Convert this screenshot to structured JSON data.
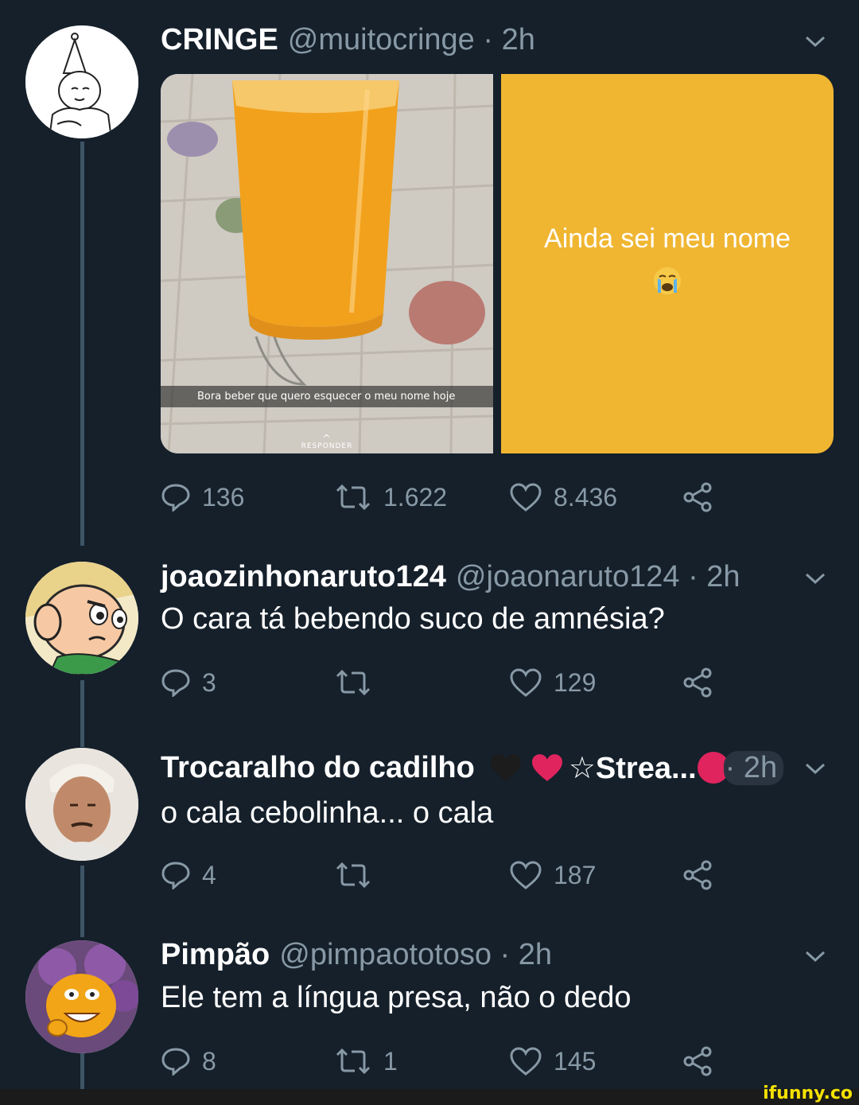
{
  "tweets": [
    {
      "name": "CRINGE",
      "handle": "@muitocringe",
      "sep": "·",
      "time": "2h",
      "media_left_caption": "Bora beber que quero esquecer o meu nome hoje",
      "media_left_reply": "RESPONDER",
      "media_right_text": "Ainda sei meu nome",
      "replies": "136",
      "retweets": "1.622",
      "likes": "8.436"
    },
    {
      "name": "joaozinhonaruto124",
      "handle": "@joaonaruto124",
      "sep": "·",
      "time": "2h",
      "text": "O cara tá bebendo suco de amnésia?",
      "replies": "3",
      "retweets": "",
      "likes": "129"
    },
    {
      "name": "Trocaralho do cadilho",
      "name_suffix": "☆Strea...",
      "sep": "·",
      "time": "2h",
      "text": "o cala cebolinha... o cala",
      "replies": "4",
      "retweets": "",
      "likes": "187"
    },
    {
      "name": "Pimpão",
      "handle": "@pimpaototoso",
      "sep": "·",
      "time": "2h",
      "text": "Ele tem a língua presa, não o dedo",
      "replies": "8",
      "retweets": "1",
      "likes": "145"
    }
  ],
  "watermark": "ifunny.co",
  "colors": {
    "background": "#15202b",
    "secondary_text": "#8899a6",
    "thread_line": "#3d5466",
    "media_yellow": "#f0b632",
    "heart_red": "#e0245e"
  },
  "icons": [
    "reply-icon",
    "retweet-icon",
    "like-icon",
    "share-icon",
    "chevron-down-icon",
    "crying-emoji-icon",
    "heart-emoji-icon"
  ]
}
